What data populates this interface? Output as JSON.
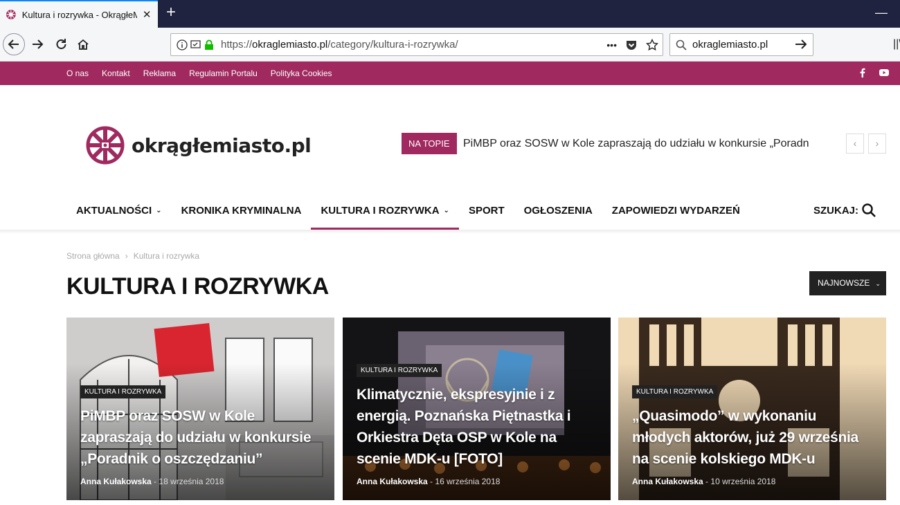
{
  "browser": {
    "tab_title": "Kultura i rozrywka - OkrągłeMiasto.pl",
    "tab_close": "✕",
    "new_tab": "+",
    "minimize": "—",
    "url_prefix": "https://",
    "url_domain": "okraglemiasto.pl",
    "url_path": "/category/kultura-i-rozrywka/",
    "page_actions": "•••",
    "search_value": "okraglemiasto.pl",
    "library": "||\\"
  },
  "topbar": {
    "links": [
      "O nas",
      "Kontakt",
      "Reklama",
      "Regulamin Portalu",
      "Polityka Cookies"
    ],
    "social_icons": [
      "facebook-icon",
      "youtube-icon"
    ]
  },
  "header": {
    "logo_text": "okrągłemiasto.pl",
    "ontop_label": "NA TOPIE",
    "ontop_text": "PiMBP oraz SOSW w Kole zapraszają do udziału w konkursie „Poradnik o oszczędzaniu”",
    "prev": "‹",
    "next": "›"
  },
  "menu": {
    "items": [
      {
        "label": "AKTUALNOŚCI",
        "dropdown": true
      },
      {
        "label": "KRONIKA KRYMINALNA",
        "dropdown": false
      },
      {
        "label": "KULTURA I ROZRYWKA",
        "dropdown": true,
        "active": true
      },
      {
        "label": "SPORT",
        "dropdown": false
      },
      {
        "label": "OGŁOSZENIA",
        "dropdown": false
      },
      {
        "label": "ZAPOWIEDZI WYDARZEŃ",
        "dropdown": false
      }
    ],
    "chevron": "⌄",
    "search_label": "SZUKAJ:"
  },
  "content": {
    "breadcrumb": [
      "Strona główna",
      "›",
      "Kultura i rozrywka"
    ],
    "title": "KULTURA I ROZRYWKA",
    "sort_label": "NAJNOWSZE",
    "sort_chevron": "⌄",
    "articles": [
      {
        "category": "KULTURA I ROZRYWKA",
        "title": "PiMBP oraz SOSW w Kole zapraszają do udziału w konkursie „Poradnik o oszczędzaniu”",
        "author": "Anna Kułakowska",
        "separator": "-",
        "date": "18 września 2018"
      },
      {
        "category": "KULTURA I ROZRYWKA",
        "title": "Klimatycznie, ekspresyjnie i z energią. Poznańska Piętnastka i Orkiestra Dęta OSP w Kole na scenie MDK-u [FOTO]",
        "author": "Anna Kułakowska",
        "separator": "-",
        "date": "16 września 2018"
      },
      {
        "category": "KULTURA I ROZRYWKA",
        "title": "„Quasimodo” w wykonaniu młodych aktorów, już 29 września na scenie kolskiego MDK-u",
        "author": "Anna Kułakowska",
        "separator": "-",
        "date": "10 września 2018"
      }
    ]
  },
  "colors": {
    "brand": "#a02a5f",
    "dark": "#222222",
    "tabbar": "#202340"
  }
}
